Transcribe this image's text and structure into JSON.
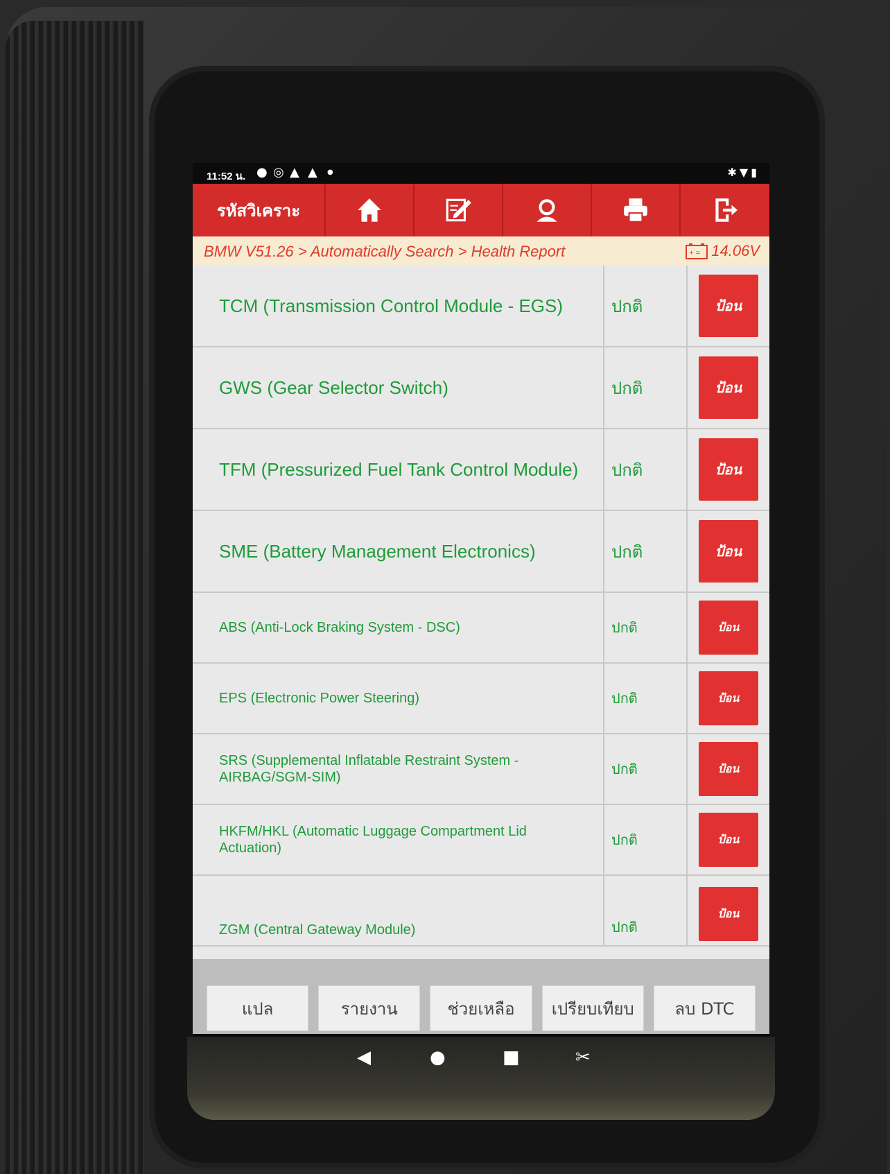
{
  "status_bar": {
    "time": "11:52 น.",
    "icons": [
      "notification-icon",
      "ev-icon",
      "warning-icon",
      "warning-icon",
      "dot-icon"
    ],
    "right_icons": [
      "bluetooth-icon",
      "wifi-icon",
      "battery-icon"
    ]
  },
  "toolbar": {
    "brand_label": "รหัสวิเคราะ",
    "buttons": [
      "home-icon",
      "edit-icon",
      "support-icon",
      "print-icon",
      "exit-icon"
    ]
  },
  "breadcrumb": {
    "path": "BMW V51.26 > Automatically Search > Health Report",
    "voltage": "14.06V"
  },
  "modules": [
    {
      "name": "TCM (Transmission Control Module - EGS)",
      "status": "ปกติ",
      "action": "ป้อน"
    },
    {
      "name": "GWS (Gear Selector Switch)",
      "status": "ปกติ",
      "action": "ป้อน"
    },
    {
      "name": "TFM (Pressurized Fuel Tank Control Module)",
      "status": "ปกติ",
      "action": "ป้อน"
    },
    {
      "name": "SME (Battery Management Electronics)",
      "status": "ปกติ",
      "action": "ป้อน"
    },
    {
      "name": "ABS (Anti-Lock Braking System - DSC)",
      "status": "ปกติ",
      "action": "ป้อน"
    },
    {
      "name": "EPS (Electronic Power Steering)",
      "status": "ปกติ",
      "action": "ป้อน"
    },
    {
      "name": "SRS (Supplemental Inflatable Restraint System - AIRBAG/SGM-SIM)",
      "status": "ปกติ",
      "action": "ป้อน"
    },
    {
      "name": "HKFM/HKL (Automatic Luggage Compartment Lid Actuation)",
      "status": "ปกติ",
      "action": "ป้อน"
    },
    {
      "name": "ZGM (Central Gateway Module)",
      "status": "ปกติ",
      "action": "ป้อน"
    }
  ],
  "bottom_buttons": {
    "translate": "แปล",
    "report": "รายงาน",
    "help": "ช่วยเหลือ",
    "compare": "เปรียบเทียบ",
    "clear_dtc": "ลบ DTC"
  },
  "nav": [
    "back-icon",
    "home-circle-icon",
    "recents-icon",
    "screenshot-icon"
  ],
  "colors": {
    "toolbar_red": "#d42b2b",
    "module_green": "#1f9b3a",
    "breadcrumb_bg": "#f7ecd2",
    "breadcrumb_text": "#e23a2a"
  }
}
